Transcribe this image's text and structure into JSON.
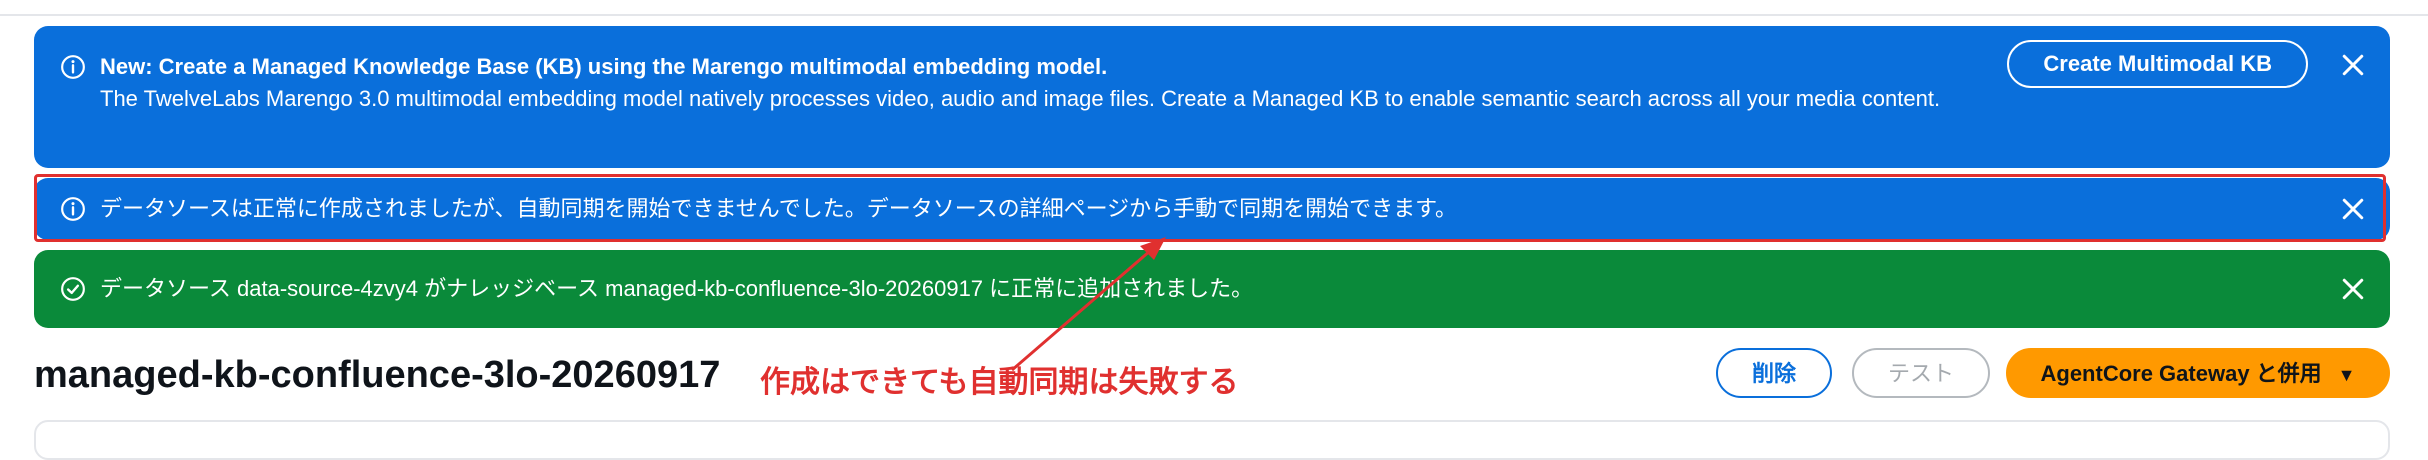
{
  "flashes": {
    "kb_notice": {
      "title": "New: Create a Managed Knowledge Base (KB) using the Marengo multimodal embedding model.",
      "body": "The TwelveLabs Marengo 3.0 multimodal embedding model natively processes video, audio and image files. Create a Managed KB to enable semantic search across all your media content.",
      "action_label": "Create Multimodal KB",
      "icon": "info-icon",
      "close_icon": "close-icon"
    },
    "sync_warning": {
      "message": "データソースは正常に作成されましたが、自動同期を開始できませんでした。データソースの詳細ページから手動で同期を開始できます。",
      "icon": "info-icon",
      "close_icon": "close-icon"
    },
    "success": {
      "message": "データソース data-source-4zvy4 がナレッジベース managed-kb-confluence-3lo-20260917 に正常に追加されました。",
      "icon": "check-circle-icon",
      "close_icon": "close-icon"
    }
  },
  "header": {
    "title": "managed-kb-confluence-3lo-20260917",
    "delete_label": "削除",
    "test_label": "テスト",
    "primary_label": "AgentCore Gateway と併用",
    "primary_caret": "▼"
  },
  "annotation": {
    "text": "作成はできても自動同期は失敗する"
  },
  "colors": {
    "info": "#0a6fdb",
    "success": "#0a8a3a",
    "primary": "#ff9900",
    "annotation": "#e0302f"
  }
}
